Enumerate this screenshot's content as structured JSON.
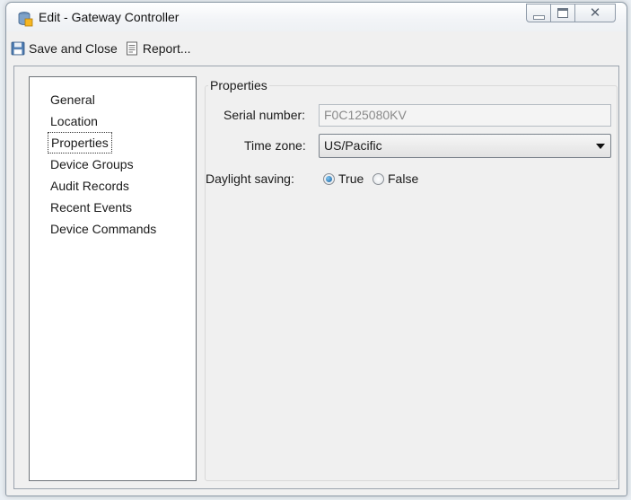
{
  "window": {
    "title": "Edit - Gateway Controller",
    "close_glyph": "✕",
    "icons": [
      "database-gateway-icon",
      "minimize-icon",
      "maximize-icon",
      "close-icon"
    ]
  },
  "toolbar": {
    "save_close_label": "Save and Close",
    "save_icon": "floppy-disk-icon",
    "report_label": "Report...",
    "report_icon": "report-icon"
  },
  "nav": {
    "items": [
      {
        "label": "General"
      },
      {
        "label": "Location"
      },
      {
        "label": "Properties",
        "selected": true
      },
      {
        "label": "Device Groups"
      },
      {
        "label": "Audit Records"
      },
      {
        "label": "Recent Events"
      },
      {
        "label": "Device Commands"
      }
    ]
  },
  "properties": {
    "group_title": "Properties",
    "serial_label": "Serial number:",
    "serial_value": "F0C125080KV",
    "timezone_label": "Time zone:",
    "timezone_value": "US/Pacific",
    "daylight_label": "Daylight saving:",
    "daylight_options": [
      {
        "label": "True",
        "checked": true
      },
      {
        "label": "False",
        "checked": false
      }
    ]
  },
  "colors": {
    "window_bg": "#f0f0f0",
    "radio_selected": "#1a5f9c"
  }
}
